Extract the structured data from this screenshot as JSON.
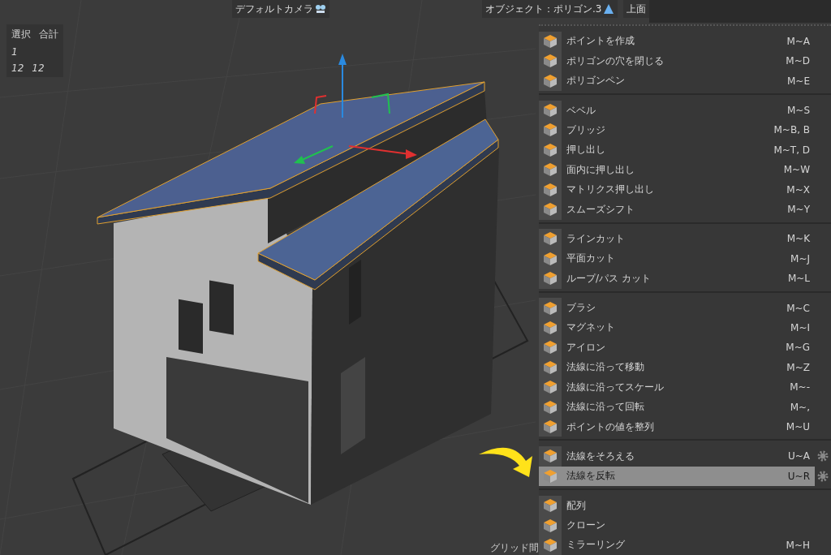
{
  "viewport": {
    "camera_label": "デフォルトカメラ",
    "object_label": "オブジェクト：ポリゴン.3",
    "view_label": "上面",
    "grid_label": "グリッド間"
  },
  "stats": {
    "headers": [
      "選択",
      "合計"
    ],
    "rows": [
      [
        "1"
      ],
      [
        "12",
        "12"
      ]
    ]
  },
  "menu": {
    "groups": [
      [
        {
          "label": "ポイントを作成",
          "shortcut": "M~A",
          "selected": false,
          "settings": false
        },
        {
          "label": "ポリゴンの穴を閉じる",
          "shortcut": "M~D",
          "selected": false,
          "settings": false
        },
        {
          "label": "ポリゴンペン",
          "shortcut": "M~E",
          "selected": false,
          "settings": false
        }
      ],
      [
        {
          "label": "ベベル",
          "shortcut": "M~S",
          "selected": false,
          "settings": false
        },
        {
          "label": "ブリッジ",
          "shortcut": "M~B, B",
          "selected": false,
          "settings": false
        },
        {
          "label": "押し出し",
          "shortcut": "M~T, D",
          "selected": false,
          "settings": false
        },
        {
          "label": "面内に押し出し",
          "shortcut": "M~W",
          "selected": false,
          "settings": false
        },
        {
          "label": "マトリクス押し出し",
          "shortcut": "M~X",
          "selected": false,
          "settings": false
        },
        {
          "label": "スムーズシフト",
          "shortcut": "M~Y",
          "selected": false,
          "settings": false
        }
      ],
      [
        {
          "label": "ラインカット",
          "shortcut": "M~K",
          "selected": false,
          "settings": false
        },
        {
          "label": "平面カット",
          "shortcut": "M~J",
          "selected": false,
          "settings": false
        },
        {
          "label": "ループ/パス カット",
          "shortcut": "M~L",
          "selected": false,
          "settings": false
        }
      ],
      [
        {
          "label": "ブラシ",
          "shortcut": "M~C",
          "selected": false,
          "settings": false
        },
        {
          "label": "マグネット",
          "shortcut": "M~I",
          "selected": false,
          "settings": false
        },
        {
          "label": "アイロン",
          "shortcut": "M~G",
          "selected": false,
          "settings": false
        },
        {
          "label": "法線に沿って移動",
          "shortcut": "M~Z",
          "selected": false,
          "settings": false
        },
        {
          "label": "法線に沿ってスケール",
          "shortcut": "M~-",
          "selected": false,
          "settings": false
        },
        {
          "label": "法線に沿って回転",
          "shortcut": "M~,",
          "selected": false,
          "settings": false
        },
        {
          "label": "ポイントの値を整列",
          "shortcut": "M~U",
          "selected": false,
          "settings": false
        }
      ],
      [
        {
          "label": "法線をそろえる",
          "shortcut": "U~A",
          "selected": false,
          "settings": true
        },
        {
          "label": "法線を反転",
          "shortcut": "U~R",
          "selected": true,
          "settings": true
        }
      ],
      [
        {
          "label": "配列",
          "selected": false,
          "settings": false
        },
        {
          "label": "クローン",
          "selected": false,
          "settings": false
        },
        {
          "label": "ミラーリング",
          "shortcut": "M~H",
          "selected": false,
          "settings": false
        }
      ]
    ]
  }
}
